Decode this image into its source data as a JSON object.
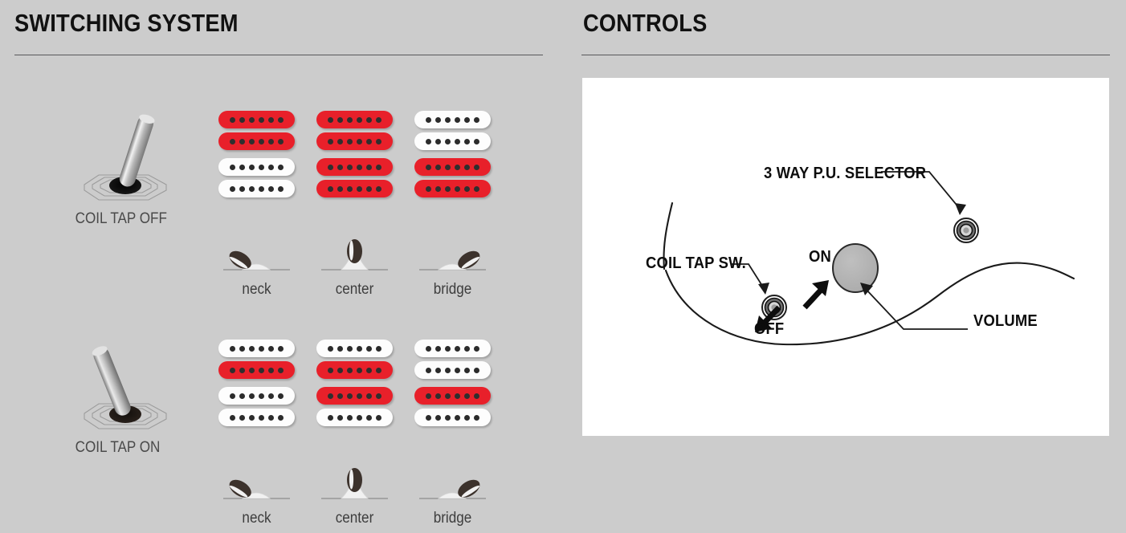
{
  "sections": {
    "switching": {
      "title": "SWITCHING SYSTEM"
    },
    "controls": {
      "title": "CONTROLS"
    }
  },
  "colors": {
    "background": "#cccccc",
    "panel": "#ffffff",
    "active_coil": "#e8202a",
    "inactive_coil": "#fdfdfd",
    "pole_piece": "#2f2f2f",
    "rule": "#58585a",
    "heading_text": "#111111",
    "caption_text": "#3d3d3d",
    "knob_fill": "#b3b3b3"
  },
  "switching": {
    "groups": [
      {
        "id": "coil-tap-off",
        "label": "COIL TAP OFF",
        "toggle_icon": "toggle-switch-right-icon",
        "toggle_position": "right",
        "positions": [
          {
            "name": "neck",
            "caption": "neck",
            "selector_icon": "selector-neck-icon",
            "pickups": [
              {
                "slot": "neck",
                "coils": [
                  "red",
                  "red"
                ]
              },
              {
                "slot": "bridge",
                "coils": [
                  "white",
                  "white"
                ]
              }
            ]
          },
          {
            "name": "center",
            "caption": "center",
            "selector_icon": "selector-center-icon",
            "pickups": [
              {
                "slot": "neck",
                "coils": [
                  "red",
                  "red"
                ]
              },
              {
                "slot": "bridge",
                "coils": [
                  "red",
                  "red"
                ]
              }
            ]
          },
          {
            "name": "bridge",
            "caption": "bridge",
            "selector_icon": "selector-bridge-icon",
            "pickups": [
              {
                "slot": "neck",
                "coils": [
                  "white",
                  "white"
                ]
              },
              {
                "slot": "bridge",
                "coils": [
                  "red",
                  "red"
                ]
              }
            ]
          }
        ]
      },
      {
        "id": "coil-tap-on",
        "label": "COIL TAP ON",
        "toggle_icon": "toggle-switch-left-icon",
        "toggle_position": "left",
        "positions": [
          {
            "name": "neck",
            "caption": "neck",
            "selector_icon": "selector-neck-icon",
            "pickups": [
              {
                "slot": "neck",
                "coils": [
                  "white",
                  "red"
                ]
              },
              {
                "slot": "bridge",
                "coils": [
                  "white",
                  "white"
                ]
              }
            ]
          },
          {
            "name": "center",
            "caption": "center",
            "selector_icon": "selector-center-icon",
            "pickups": [
              {
                "slot": "neck",
                "coils": [
                  "white",
                  "red"
                ]
              },
              {
                "slot": "bridge",
                "coils": [
                  "red",
                  "white"
                ]
              }
            ]
          },
          {
            "name": "bridge",
            "caption": "bridge",
            "selector_icon": "selector-bridge-icon",
            "pickups": [
              {
                "slot": "neck",
                "coils": [
                  "white",
                  "white"
                ]
              },
              {
                "slot": "bridge",
                "coils": [
                  "red",
                  "white"
                ]
              }
            ]
          }
        ]
      }
    ],
    "poles_per_coil": 6
  },
  "controls": {
    "labels": {
      "pu_selector": "3 WAY P.U. SELECTOR",
      "coil_tap_sw": "COIL TAP SW.",
      "on": "ON",
      "off": "OFF",
      "volume": "VOLUME"
    },
    "elements": [
      {
        "name": "pu-selector-switch",
        "icon": "concentric-switch-icon"
      },
      {
        "name": "coil-tap-switch",
        "icon": "concentric-switch-icon"
      },
      {
        "name": "volume-knob",
        "icon": "knob-icon"
      }
    ]
  }
}
